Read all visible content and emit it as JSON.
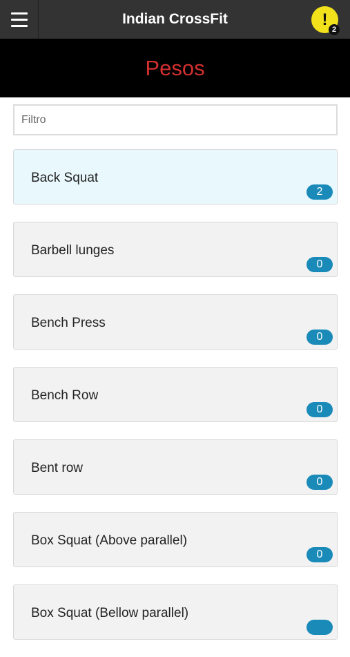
{
  "header": {
    "title": "Indian CrossFit",
    "alert_icon": "!",
    "alert_count": "2"
  },
  "hero": {
    "title": "Pesos"
  },
  "filter": {
    "placeholder": "Filtro",
    "value": ""
  },
  "items": [
    {
      "label": "Back Squat",
      "count": "2"
    },
    {
      "label": "Barbell lunges",
      "count": "0"
    },
    {
      "label": "Bench Press",
      "count": "0"
    },
    {
      "label": "Bench Row",
      "count": "0"
    },
    {
      "label": "Bent row",
      "count": "0"
    },
    {
      "label": "Box Squat (Above parallel)",
      "count": "0"
    },
    {
      "label": "Box Squat (Bellow parallel)",
      "count": ""
    }
  ],
  "colors": {
    "topbar": "#333333",
    "hero_bg": "#000000",
    "hero_text": "#d32f2f",
    "alert": "#f2e21b",
    "badge": "#1a8ab8",
    "active_item": "#e8f8fd"
  }
}
